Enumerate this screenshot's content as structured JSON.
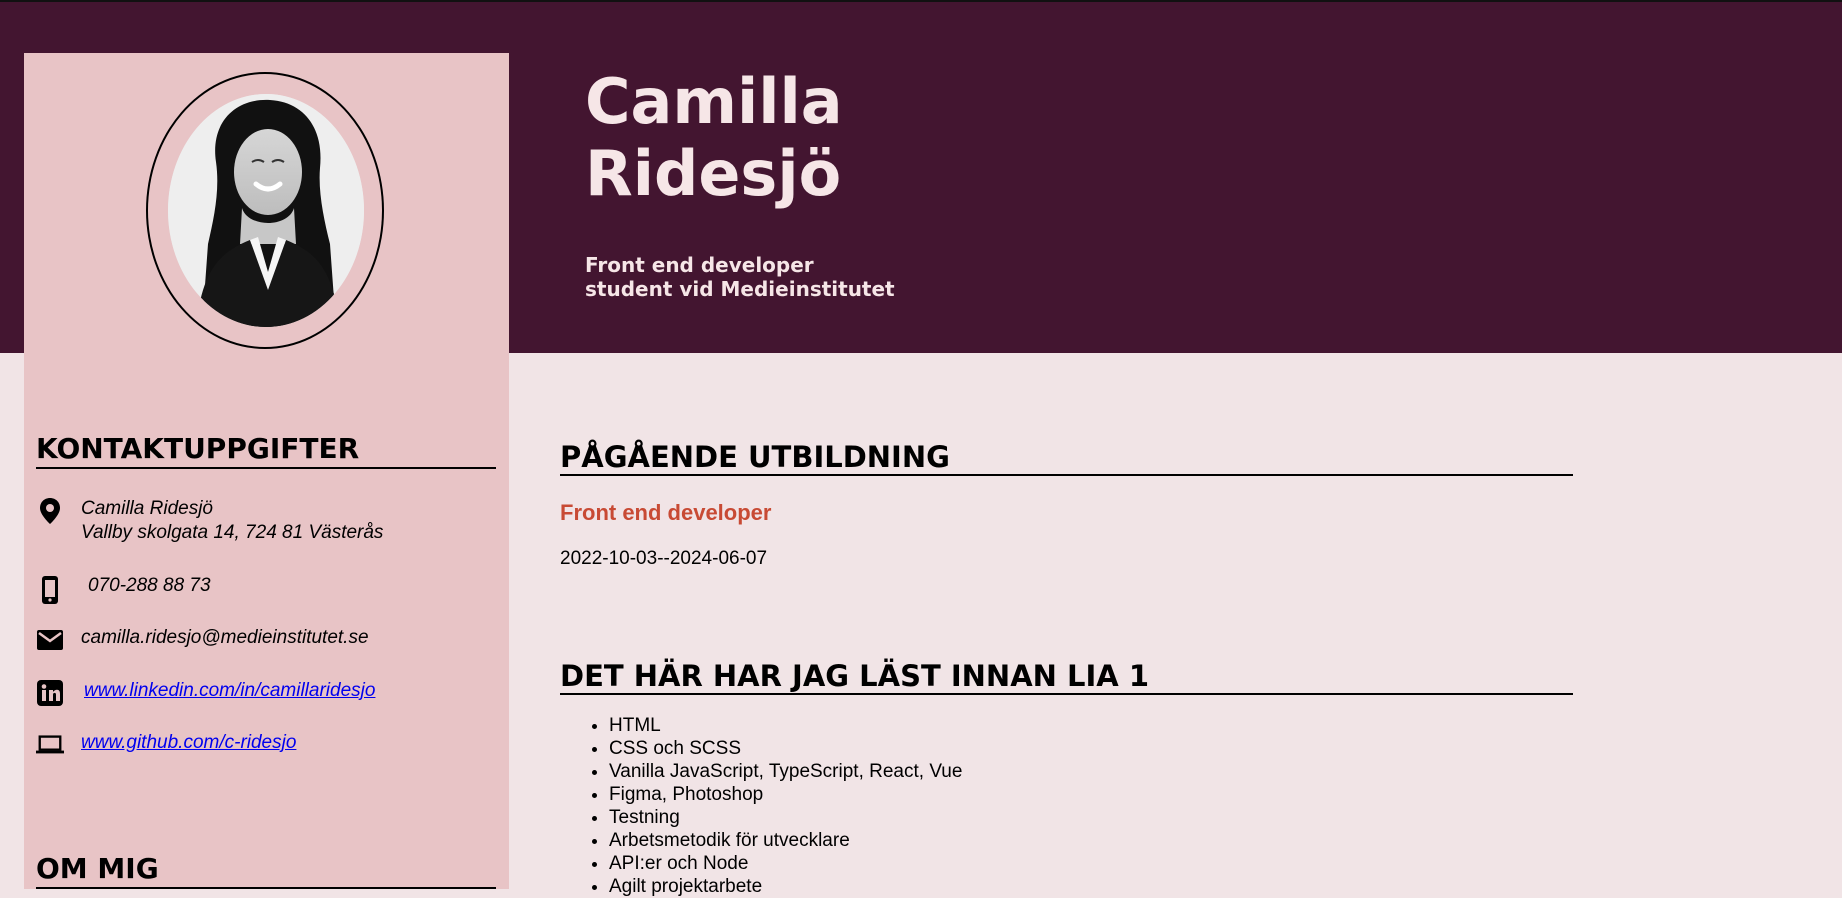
{
  "header": {
    "name_first": "Camilla",
    "name_last": "Ridesjö",
    "subtitle_line1": "Front end developer",
    "subtitle_line2": "student vid Medieinstitutet"
  },
  "sidebar": {
    "contact_heading": "KONTAKTUPPGIFTER",
    "contact": {
      "name": "Camilla Ridesjö",
      "address": "Vallby skolgata 14, 724 81 Västerås",
      "phone": "070-288 88 73",
      "email": "camilla.ridesjo@medieinstitutet.se",
      "linkedin": "www.linkedin.com/in/camillaridesjo",
      "github": "www.github.com/c-ridesjo"
    },
    "about_heading": "OM MIG"
  },
  "main": {
    "education_heading": "PÅGÅENDE UTBILDNING",
    "program": "Front end developer",
    "dates": "2022-10-03--2024-06-07",
    "courses_heading": "DET HÄR HAR JAG LÄST INNAN LIA 1",
    "courses": [
      "HTML",
      "CSS och SCSS",
      "Vanilla JavaScript, TypeScript, React, Vue",
      "Figma, Photoshop",
      "Testning",
      "Arbetsmetodik för utvecklare",
      "API:er och Node",
      "Agilt projektarbete"
    ]
  },
  "icons": {
    "address": "location-pin-icon",
    "phone": "mobile-phone-icon",
    "email": "email-icon",
    "linkedin": "linkedin-icon",
    "github": "laptop-icon"
  },
  "colors": {
    "header_background": "#431530",
    "sidebar_background": "#e8c4c6",
    "page_background": "#f1e4e6",
    "header_text": "#f6e6e7",
    "program_accent": "#c84a34",
    "link": "#0000ee"
  }
}
